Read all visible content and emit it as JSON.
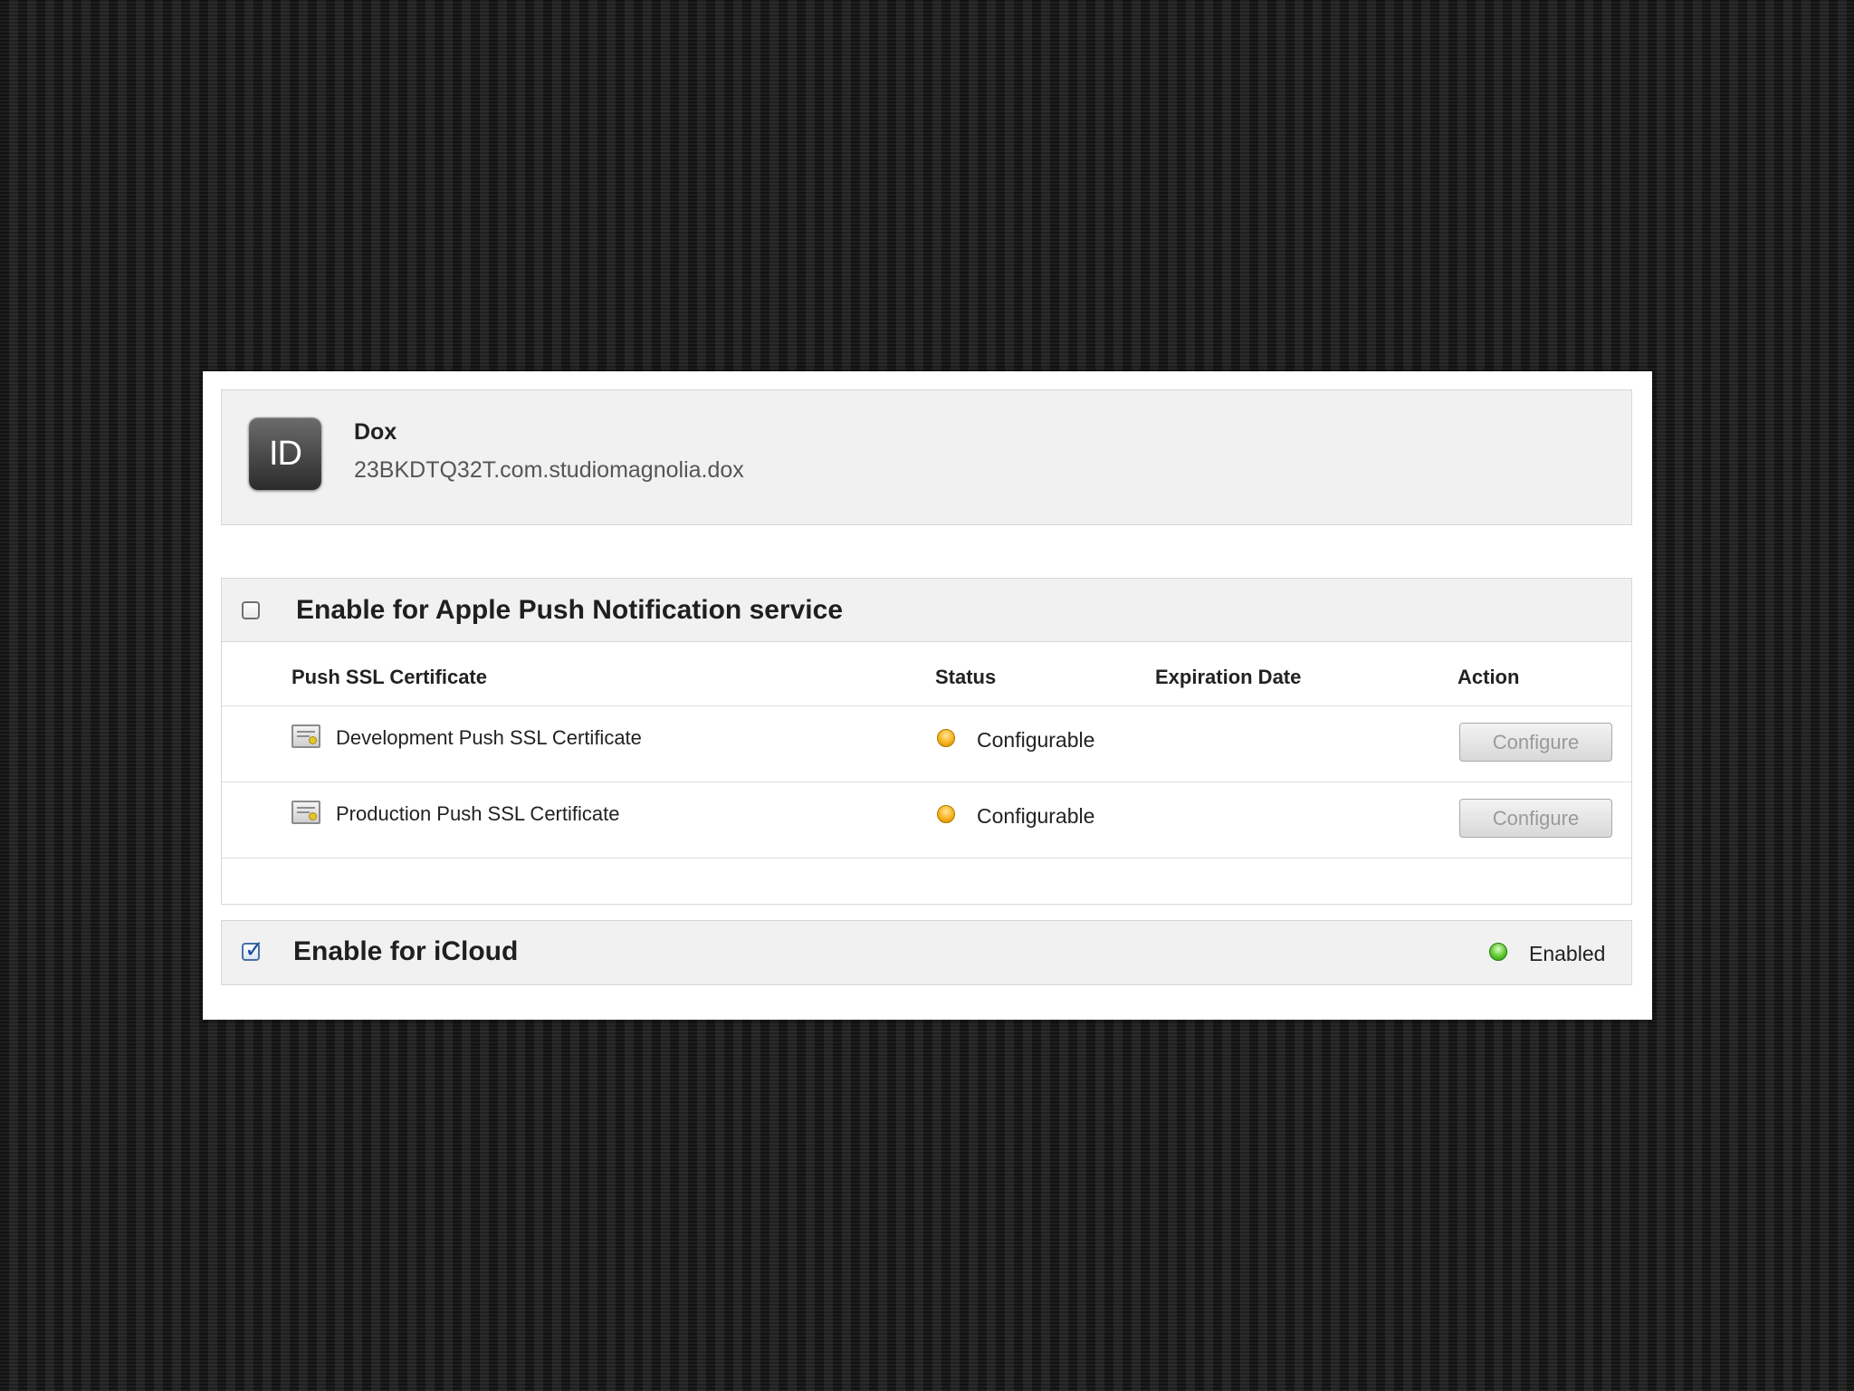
{
  "app": {
    "icon_label": "ID",
    "name": "Dox",
    "bundle_id": "23BKDTQ32T.com.studiomagnolia.dox"
  },
  "push": {
    "checked": false,
    "title": "Enable for Apple Push Notification service",
    "columns": {
      "certificate": "Push SSL Certificate",
      "status": "Status",
      "expiration": "Expiration Date",
      "action": "Action"
    },
    "rows": [
      {
        "certificate": "Development Push SSL Certificate",
        "status": "Configurable",
        "status_color": "#f7b21b",
        "expiration": "",
        "action": "Configure"
      },
      {
        "certificate": "Production Push SSL Certificate",
        "status": "Configurable",
        "status_color": "#f7b21b",
        "expiration": "",
        "action": "Configure"
      }
    ]
  },
  "icloud": {
    "checked": true,
    "title": "Enable for iCloud",
    "status": "Enabled",
    "status_color": "#5cc82e"
  }
}
